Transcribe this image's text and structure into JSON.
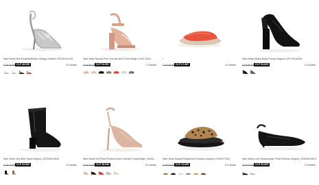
{
  "products": [
    {
      "name": "Nine West Hirit Rhodes/Metallic Strappy Heeled | ZEO2015-001",
      "old_price": "CLP 79.990",
      "new_price": "CLP 48.090",
      "colors": "4 Colores",
      "shoe": "silver-strappy-heel",
      "swatch_colors": [
        "#b8b8b8",
        "#d9c0a0",
        "#1a1a1a",
        "#c23b2c"
      ]
    },
    {
      "name": "Nine West Sandal Pink Cremas MIO2 Heel Beige | 0157-0024",
      "old_price": "CLP 89.750",
      "new_price": "CLP 54.901",
      "colors": "7 Colores",
      "shoe": "beige-block-sandal",
      "swatch_colors": [
        "#e3b9a4",
        "#d8c6b4",
        "#111111",
        "#9a7b62",
        "#c84a3a",
        "#e9e0d4",
        "#6f6f6f"
      ]
    },
    {
      "name": "/",
      "old_price": "CLP 45.990",
      "new_price": "CLP 27.487",
      "colors": "4 Colores",
      "shoe": "orange-slide",
      "swatch_colors": [
        "#e8533a",
        "#111111",
        "#c9b89e",
        "#f2f2f2"
      ]
    },
    {
      "name": "Nine West Abbey Block Pumps Negros | ZPY195-B014",
      "old_price": "CLP 99.990",
      "new_price": "CLP 54.825",
      "colors": "2 Colores",
      "shoe": "black-block-pump",
      "swatch_colors": [
        "#111111",
        "#6b5a4a"
      ]
    },
    {
      "name": "Nine West Very Bird Teach Negros | ZEO094-A020",
      "old_price": "CLP 74.990",
      "new_price": "CLP 34.362",
      "colors": "2 Colores",
      "shoe": "black-ankle-boot",
      "swatch_colors": [
        "#111111",
        "#8b6a4f"
      ]
    },
    {
      "name": "Nine West Pair Pinta Perfecto Ante Cremas Puntal Beige | 0ID30-3020",
      "old_price": "CLP 79.990",
      "new_price": "CLP 48.038",
      "colors": "5 Colores",
      "shoe": "nude-ankle-strap-pump",
      "swatch_colors": [
        "#d9b8a6",
        "#111111",
        "#c43a2e",
        "#b5b5b5",
        "#e8e2d6"
      ]
    },
    {
      "name": "Nine West Sandal Plataforma Chunks Leopardo ZV9C5-Y020",
      "old_price": "CLP 69.990",
      "new_price": "CLP 13.665",
      "colors": "6 Colores",
      "shoe": "leopard-platform-slide",
      "swatch_colors": [
        "#a77c4a",
        "#111111",
        "#e8e2d6",
        "#8a8a8a",
        "#c9a06a",
        "#5d4a36"
      ]
    },
    {
      "name": "Nine West Luxe Gelbcompair Pinta Perfecto Negros | ZD0I9N-N019",
      "old_price": "CLP 74.990",
      "new_price": "CLP 54.825",
      "colors": "2 Colores",
      "shoe": "black-slingback-flat",
      "swatch_colors": [
        "#111111",
        "#c9b89e"
      ]
    }
  ]
}
